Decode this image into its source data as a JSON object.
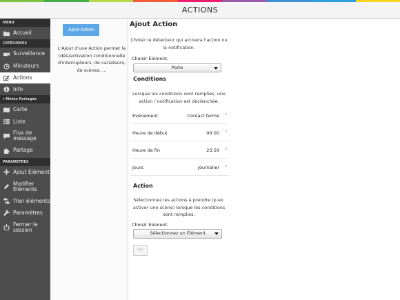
{
  "header": {
    "title": "ACTIONS"
  },
  "stripe_colors": [
    "#7cc242",
    "#3fae49",
    "#b6d94c",
    "#f15a3b",
    "#ed1c6e",
    "#9a5ba8",
    "#3b8fd3",
    "#2b9fd9",
    "#f9d423"
  ],
  "sidebar": {
    "menu_section": "MENU",
    "accueil": "Accueil",
    "categories_section": "CATÉGORIES",
    "surveillance": "Surveillance",
    "minuteurs": "Minuteurs",
    "actions": "Actions",
    "info": "Info",
    "meteo_section": "Météo Partagée",
    "carte": "Carte",
    "liste": "Liste",
    "flux": "Flux de message",
    "partage": "Partage",
    "parametres_section": "PARAMETRES",
    "ajout_element": "Ajout Élément",
    "modifier_elements": "Modifier Éléments",
    "trier_elements": "Trier éléments",
    "parametres": "Paramètres",
    "fermer_session": "Fermer la session"
  },
  "info": {
    "button": "Ajout Action",
    "text": "L'Ajout d'une Action permet la (dés)activation conditionnelle d'interrupteurs, de variateurs, de scènes, ..."
  },
  "main": {
    "title": "Ajout Action",
    "intro": "Choisir le détecteur qui activera l'action ou la notification.",
    "choose_label": "Choisir Elément:",
    "choose_value": "Porte",
    "conditions_title": "Conditions",
    "conditions_text": "Lorsque les conditions sont remplies, une action / notification est déclenchée.",
    "rows": [
      {
        "key": "Evénement",
        "value": "Contact fermé"
      },
      {
        "key": "Heure de début",
        "value": "00:00"
      },
      {
        "key": "Heure de fin",
        "value": "23:59"
      },
      {
        "key": "Jours",
        "value": "Journalier"
      }
    ],
    "action_title": "Action",
    "action_text": "Sélectionnez les actions à prendre (p.ex. activer une scène) lorsque les conditions sont remplies.",
    "choose2_label": "Choisir Elément:",
    "choose2_value": "Sélectionnez un Élément",
    "ok": "OK"
  }
}
